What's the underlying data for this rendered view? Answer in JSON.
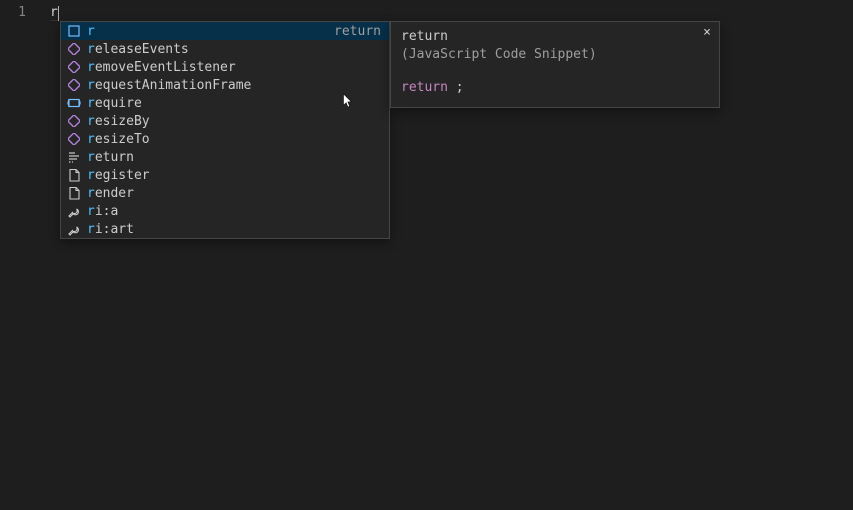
{
  "editor": {
    "line_number": "1",
    "typed": "r"
  },
  "suggest": {
    "selected_index": 0,
    "selected_hint": "return",
    "items": [
      {
        "icon": "keyword",
        "match": "r",
        "rest": ""
      },
      {
        "icon": "method",
        "match": "r",
        "rest": "eleaseEvents"
      },
      {
        "icon": "method",
        "match": "r",
        "rest": "emoveEventListener"
      },
      {
        "icon": "method",
        "match": "r",
        "rest": "equestAnimationFrame"
      },
      {
        "icon": "variable",
        "match": "r",
        "rest": "equire"
      },
      {
        "icon": "method",
        "match": "r",
        "rest": "esizeBy"
      },
      {
        "icon": "method",
        "match": "r",
        "rest": "esizeTo"
      },
      {
        "icon": "snippet",
        "match": "r",
        "rest": "eturn"
      },
      {
        "icon": "file",
        "match": "r",
        "rest": "egister"
      },
      {
        "icon": "file",
        "match": "r",
        "rest": "ender"
      },
      {
        "icon": "tool",
        "match": "r",
        "rest": "i:a"
      },
      {
        "icon": "tool",
        "match": "r",
        "rest": "i:art"
      }
    ]
  },
  "detail": {
    "title": "return",
    "subtitle": "(JavaScript Code Snippet)",
    "code_keyword": "return",
    "code_suffix": " ;"
  }
}
